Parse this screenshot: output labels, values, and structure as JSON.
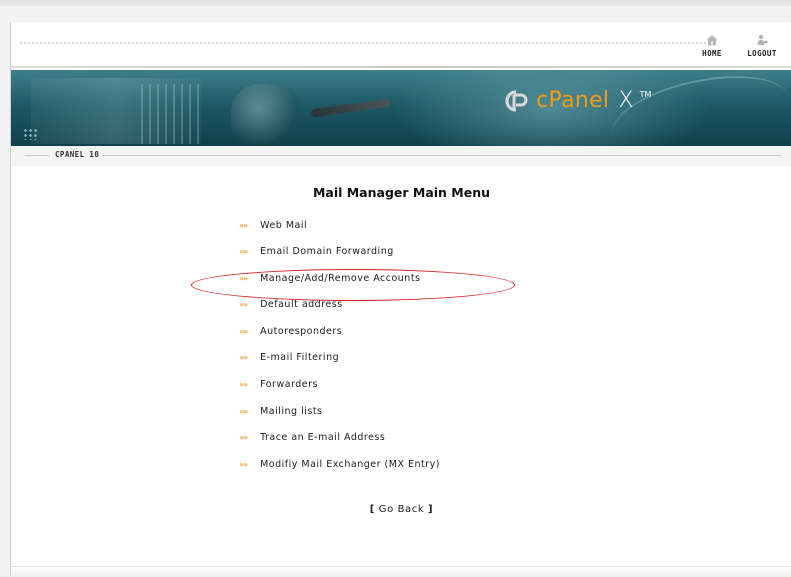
{
  "header": {
    "nav": {
      "home_label": "HOME",
      "logout_label": "LOGOUT"
    },
    "brand": {
      "name": "cPanel",
      "suffix": "X",
      "tm": "TM"
    },
    "version_label": "CPANEL 10"
  },
  "main": {
    "title": "Mail Manager Main Menu",
    "bullet": "»»",
    "menu_items": [
      {
        "label": "Web Mail"
      },
      {
        "label": "Email Domain Forwarding"
      },
      {
        "label": "Manage/Add/Remove Accounts"
      },
      {
        "label": "Default address"
      },
      {
        "label": "Autoresponders"
      },
      {
        "label": "E-mail Filtering"
      },
      {
        "label": "Forwarders"
      },
      {
        "label": "Mailing lists"
      },
      {
        "label": "Trace an E-mail Address"
      },
      {
        "label": "Modifiy Mail Exchanger (MX Entry)"
      }
    ],
    "go_back": {
      "open": "[",
      "label": "Go Back",
      "close": "]"
    }
  },
  "colors": {
    "accent": "#f0a33c",
    "brand_orange": "#f39c12",
    "banner_teal": "#1d5966",
    "highlight_red": "#d62020"
  },
  "icons": {
    "home": "home-icon",
    "logout": "logout-icon",
    "logo": "cpanel-logo-icon",
    "bullet": "double-chevron-icon"
  }
}
